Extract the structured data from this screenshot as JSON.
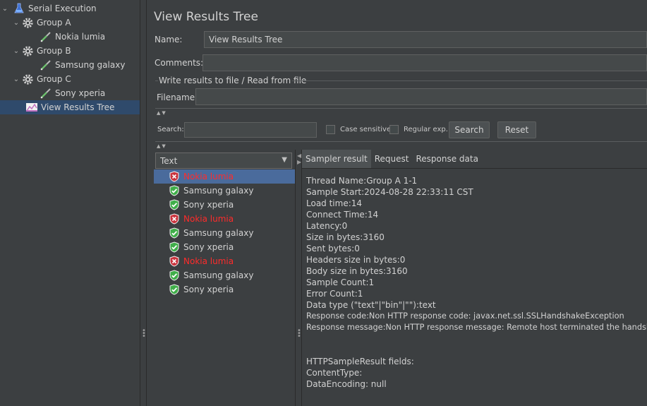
{
  "tree": {
    "items": [
      {
        "label": "Serial Execution"
      },
      {
        "label": "Group A"
      },
      {
        "label": "Nokia lumia"
      },
      {
        "label": "Group B"
      },
      {
        "label": "Samsung galaxy"
      },
      {
        "label": "Group C"
      },
      {
        "label": "Sony xperia"
      },
      {
        "label": "View Results Tree"
      }
    ]
  },
  "panel": {
    "title": "View Results Tree",
    "name_label": "Name:",
    "name_value": "View Results Tree",
    "comments_label": "Comments:",
    "comments_value": "",
    "file_group_label": "Write results to file / Read from file",
    "filename_label": "Filename",
    "filename_value": "",
    "search_label": "Search:",
    "search_value": "",
    "case_sensitive_label": "Case sensitive",
    "regex_label": "Regular exp.",
    "search_button": "Search",
    "reset_button": "Reset",
    "collapse_arrows": "▲▼"
  },
  "results": {
    "renderer": "Text",
    "items": [
      {
        "label": "Nokia lumia",
        "status": "error"
      },
      {
        "label": "Samsung galaxy",
        "status": "success"
      },
      {
        "label": "Sony xperia",
        "status": "success"
      },
      {
        "label": "Nokia lumia",
        "status": "error"
      },
      {
        "label": "Samsung galaxy",
        "status": "success"
      },
      {
        "label": "Sony xperia",
        "status": "success"
      },
      {
        "label": "Nokia lumia",
        "status": "error"
      },
      {
        "label": "Samsung galaxy",
        "status": "success"
      },
      {
        "label": "Sony xperia",
        "status": "success"
      }
    ]
  },
  "tabs": [
    "Sampler result",
    "Request",
    "Response data"
  ],
  "sampler_result": {
    "lines": [
      "Thread Name:Group A 1-1",
      "Sample Start:2024-08-28 22:33:11 CST",
      "Load time:14",
      "Connect Time:14",
      "Latency:0",
      "Size in bytes:3160",
      "Sent bytes:0",
      "Headers size in bytes:0",
      "Body size in bytes:3160",
      "Sample Count:1",
      "Error Count:1",
      "Data type (\"text\"|\"bin\"|\"\"):text",
      "Response code:Non HTTP response code: javax.net.ssl.SSLHandshakeException",
      "Response message:Non HTTP response message: Remote host terminated the handshake",
      "",
      "",
      "HTTPSampleResult fields:",
      "ContentType:",
      "DataEncoding: null"
    ]
  },
  "colors": {
    "background": "#3c3f41",
    "selection_tree": "#2f4a6b",
    "selection_list": "#4a6b9c",
    "error_text": "#ff2b2b",
    "success_icon": "#3fae49",
    "error_icon": "#c9343e"
  },
  "icons": {
    "root": "flask-icon",
    "group": "gear-icon",
    "sampler": "pipette-icon",
    "listener": "graph-icon",
    "success": "shield-check-icon",
    "error": "shield-x-icon"
  }
}
